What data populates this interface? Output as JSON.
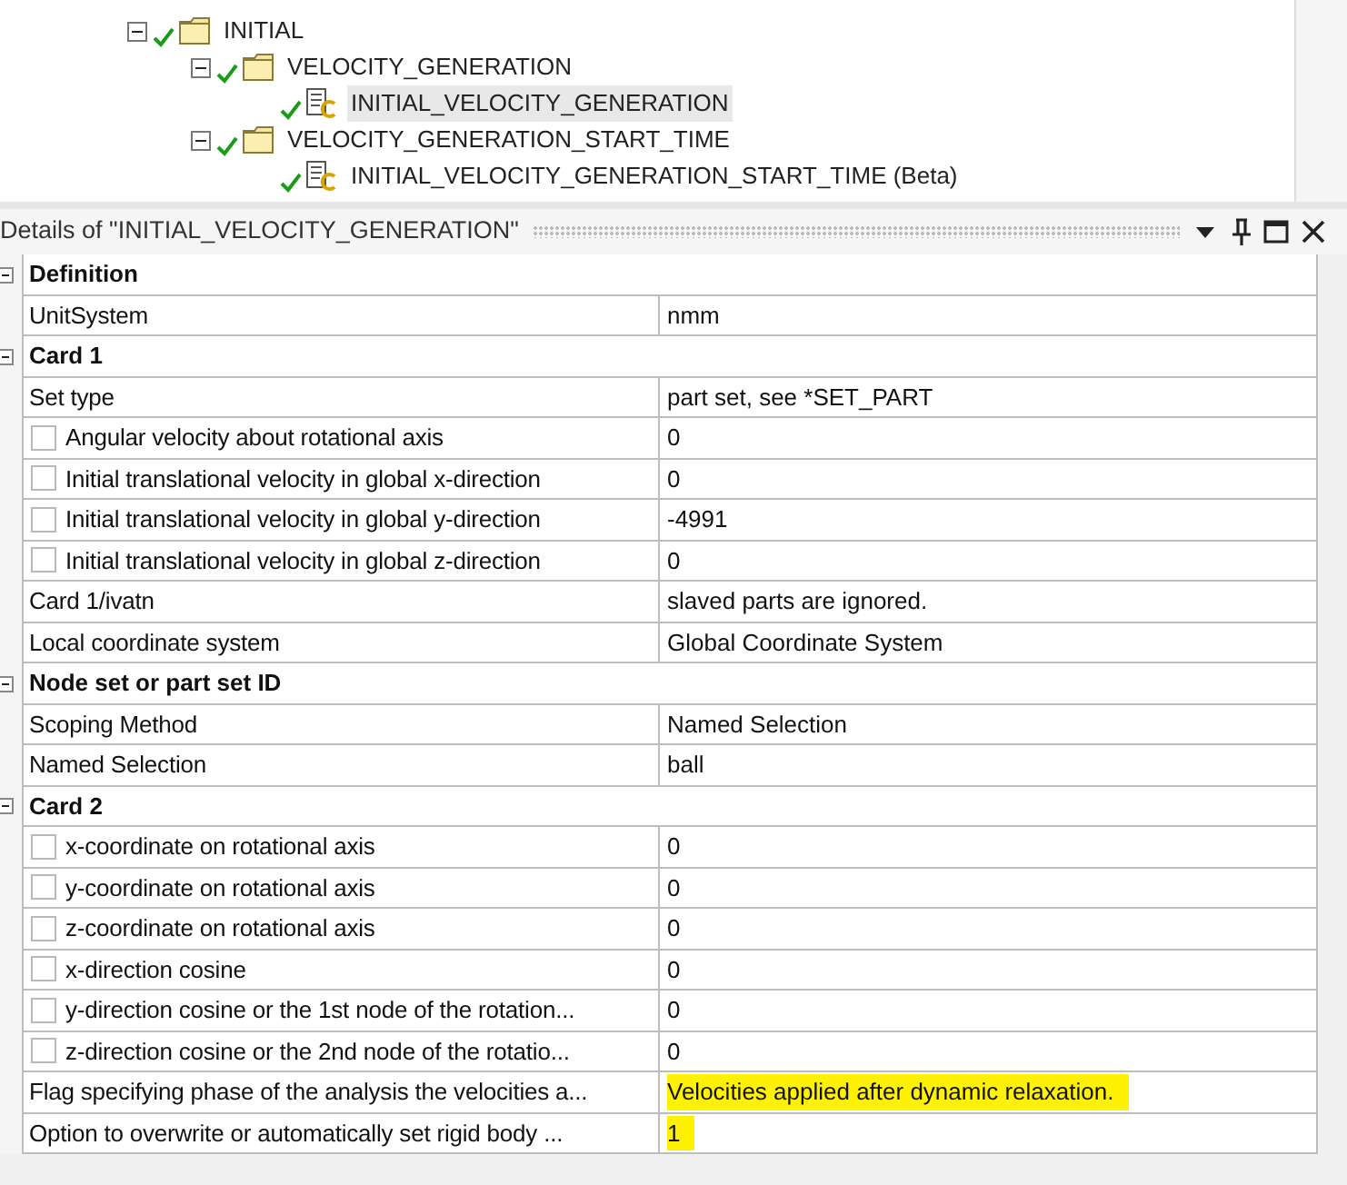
{
  "tree": [
    {
      "label": "INITIAL",
      "kind": "folder",
      "expanded": true,
      "selected": false,
      "children": [
        {
          "label": "VELOCITY_GENERATION",
          "kind": "folder",
          "expanded": true,
          "selected": false,
          "children": [
            {
              "label": "INITIAL_VELOCITY_GENERATION",
              "kind": "object",
              "selected": true
            }
          ]
        },
        {
          "label": "VELOCITY_GENERATION_START_TIME",
          "kind": "folder",
          "expanded": true,
          "selected": false,
          "children": [
            {
              "label": "INITIAL_VELOCITY_GENERATION_START_TIME (Beta)",
              "kind": "object",
              "selected": false
            }
          ]
        }
      ]
    }
  ],
  "details": {
    "title": "Details of \"INITIAL_VELOCITY_GENERATION\"",
    "rows": [
      {
        "kind": "section",
        "label": "Definition",
        "expanded": true
      },
      {
        "kind": "plain",
        "label": "UnitSystem",
        "value": "nmm",
        "highlighted": false
      },
      {
        "kind": "section",
        "label": "Card 1",
        "expanded": true
      },
      {
        "kind": "plain",
        "label": "Set type",
        "value": "part set, see *SET_PART",
        "highlighted": false
      },
      {
        "kind": "checkbox",
        "label": "Angular velocity about rotational axis",
        "value": "0",
        "checked": false,
        "highlighted": false
      },
      {
        "kind": "checkbox",
        "label": "Initial translational velocity in global x-direction",
        "value": "0",
        "checked": false,
        "highlighted": false
      },
      {
        "kind": "checkbox",
        "label": "Initial translational velocity in global y-direction",
        "value": "-4991",
        "checked": false,
        "highlighted": false
      },
      {
        "kind": "checkbox",
        "label": "Initial translational velocity in global z-direction",
        "value": "0",
        "checked": false,
        "highlighted": false
      },
      {
        "kind": "plain",
        "label": "Card 1/ivatn",
        "value": "slaved parts are ignored.",
        "highlighted": false
      },
      {
        "kind": "plain",
        "label": "Local coordinate system",
        "value": "Global Coordinate System",
        "highlighted": false
      },
      {
        "kind": "section",
        "label": "Node set or part set ID",
        "expanded": true
      },
      {
        "kind": "plain",
        "label": "Scoping Method",
        "value": "Named Selection",
        "highlighted": false
      },
      {
        "kind": "plain",
        "label": "Named Selection",
        "value": "ball",
        "highlighted": false
      },
      {
        "kind": "section",
        "label": "Card 2",
        "expanded": true
      },
      {
        "kind": "checkbox",
        "label": "x-coordinate on rotational axis",
        "value": "0",
        "checked": false,
        "highlighted": false
      },
      {
        "kind": "checkbox",
        "label": "y-coordinate on rotational axis",
        "value": "0",
        "checked": false,
        "highlighted": false
      },
      {
        "kind": "checkbox",
        "label": "z-coordinate on rotational axis",
        "value": "0",
        "checked": false,
        "highlighted": false
      },
      {
        "kind": "checkbox",
        "label": "x-direction cosine",
        "value": "0",
        "checked": false,
        "highlighted": false
      },
      {
        "kind": "checkbox",
        "label": "y-direction cosine or the 1st node of the rotation...",
        "value": "0",
        "checked": false,
        "highlighted": false
      },
      {
        "kind": "checkbox",
        "label": "z-direction cosine or the 2nd node of the rotatio...",
        "value": "0",
        "checked": false,
        "highlighted": false
      },
      {
        "kind": "plain",
        "label": "Flag specifying phase of the analysis the velocities a...",
        "value": "Velocities applied after dynamic relaxation.",
        "highlighted": true
      },
      {
        "kind": "plain",
        "label": "Option to overwrite or automatically set rigid body ...",
        "value": "1",
        "highlighted": true
      }
    ]
  }
}
